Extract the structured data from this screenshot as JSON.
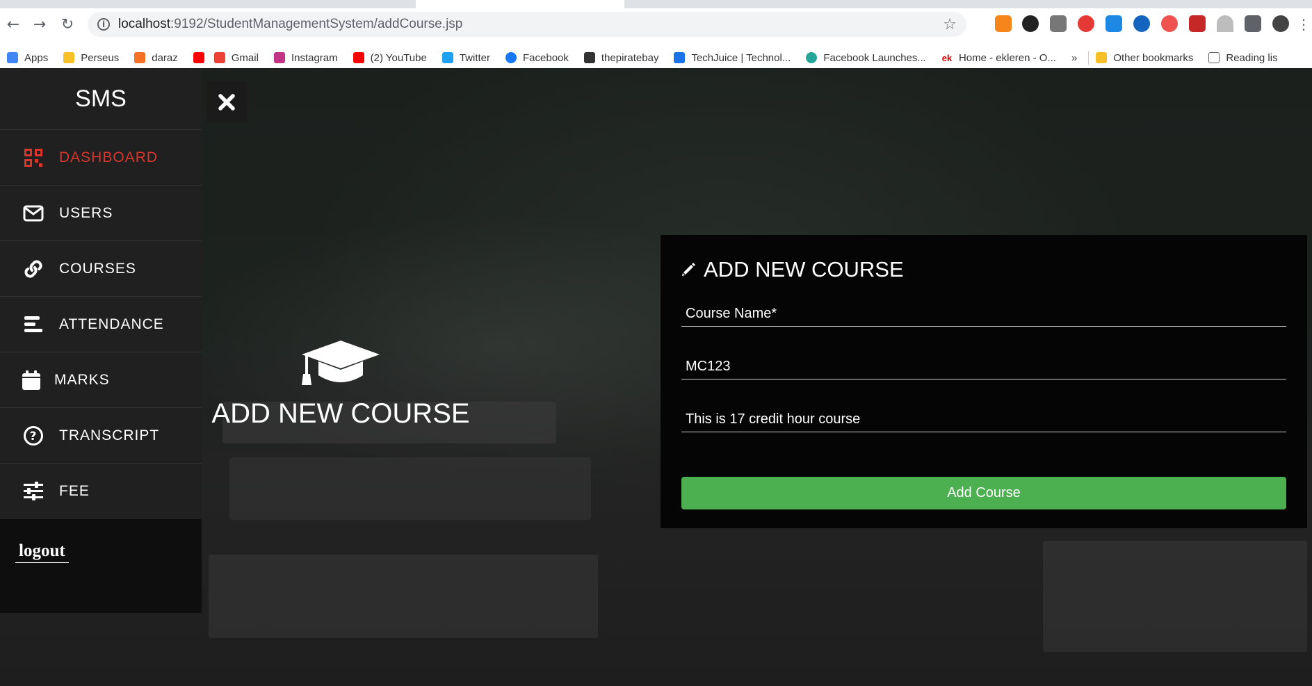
{
  "browser": {
    "url_host": "localhost",
    "url_path": ":9192/StudentManagementSystem/addCourse.jsp",
    "bookmarks": [
      {
        "label": "Apps",
        "icon": "apps-grid-icon",
        "color": "#4285f4"
      },
      {
        "label": "Perseus",
        "icon": "folder-icon",
        "color": "#f6c026"
      },
      {
        "label": "daraz",
        "icon": "daraz-icon",
        "color": "#f57224"
      },
      {
        "label": "",
        "icon": "youtube-icon",
        "color": "#ff0000"
      },
      {
        "label": "Gmail",
        "icon": "gmail-icon",
        "color": "#ea4335"
      },
      {
        "label": "Instagram",
        "icon": "instagram-icon",
        "color": "#c13584"
      },
      {
        "label": "(2) YouTube",
        "icon": "youtube-icon",
        "color": "#ff0000"
      },
      {
        "label": "Twitter",
        "icon": "twitter-icon",
        "color": "#1da1f2"
      },
      {
        "label": "Facebook",
        "icon": "facebook-icon",
        "color": "#1877f2"
      },
      {
        "label": "thepiratebay",
        "icon": "pirate-ship-icon",
        "color": "#333333"
      },
      {
        "label": "TechJuice | Technol...",
        "icon": "techjuice-icon",
        "color": "#1a73e8"
      },
      {
        "label": "Facebook Launches...",
        "icon": "leaf-icon",
        "color": "#26a69a"
      },
      {
        "label": "Home - ekleren - O...",
        "icon": "ek-icon",
        "color": "#d50000"
      }
    ],
    "overflow_label": "»",
    "other_bookmarks": "Other bookmarks",
    "reading_list": "Reading lis"
  },
  "sidebar": {
    "brand": "SMS",
    "items": [
      {
        "label": "DASHBOARD",
        "icon": "dashboard-qr-icon",
        "active": true
      },
      {
        "label": "USERS",
        "icon": "envelope-icon",
        "active": false
      },
      {
        "label": "COURSES",
        "icon": "link-icon",
        "active": false
      },
      {
        "label": "ATTENDANCE",
        "icon": "bars-icon",
        "active": false
      },
      {
        "label": "MARKS",
        "icon": "calendar-icon",
        "active": false
      },
      {
        "label": "TRANSCRIPT",
        "icon": "question-circle-icon",
        "active": false
      },
      {
        "label": "FEE",
        "icon": "sliders-icon",
        "active": false
      }
    ],
    "logout": "logout"
  },
  "hero": {
    "icon": "graduation-cap-icon",
    "title": "ADD NEW COURSE"
  },
  "form": {
    "title": "ADD NEW COURSE",
    "course_name_placeholder": "Course Name*",
    "course_code_value": "MC123",
    "description_value": "This is 17 credit hour course",
    "submit_label": "Add Course",
    "accent": "#4caf50"
  },
  "colors": {
    "active_menu": "#d9362b"
  }
}
